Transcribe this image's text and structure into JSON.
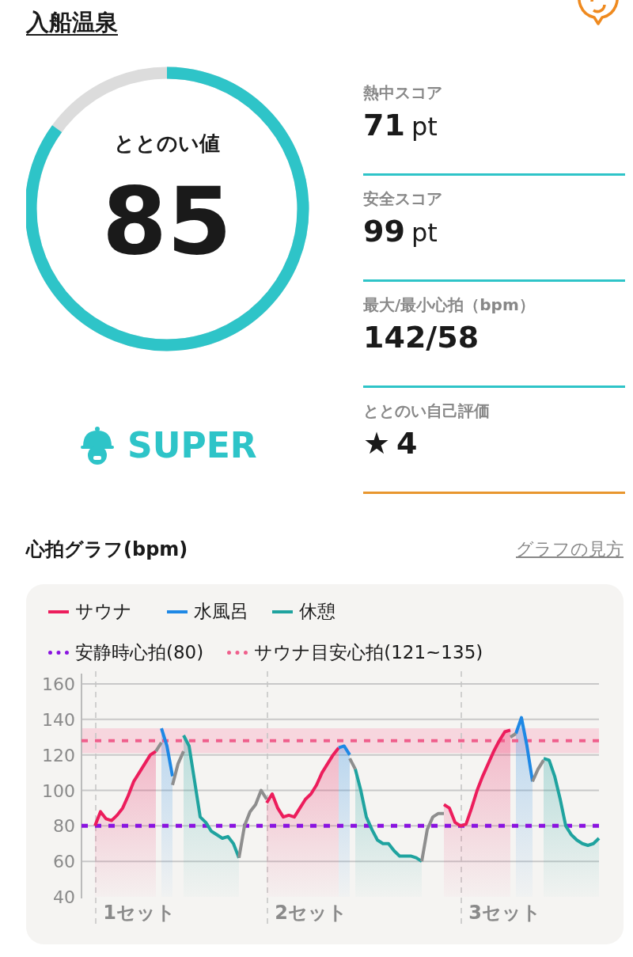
{
  "header": {
    "title": "入船温泉"
  },
  "gauge": {
    "label": "ととのい値",
    "value": "85",
    "rank": "SUPER"
  },
  "stats": [
    {
      "label": "熱中スコア",
      "value": "71",
      "unit": "pt",
      "color": "#2ec4c8"
    },
    {
      "label": "安全スコア",
      "value": "99",
      "unit": "pt",
      "color": "#2ec4c8"
    },
    {
      "label": "最大/最小心拍（bpm）",
      "value": "142/58",
      "color": "#2ec4c8"
    },
    {
      "label": "ととのい自己評価",
      "symbol": "★",
      "value": "4",
      "color": "#e8962e"
    }
  ],
  "graph": {
    "title": "心拍グラフ(bpm)",
    "help_link": "グラフの見方",
    "chart_data": {
      "type": "line",
      "ylim": [
        40,
        160
      ],
      "yticks": [
        40,
        60,
        80,
        100,
        120,
        140,
        160
      ],
      "grid": true,
      "categories": [
        null,
        null,
        null,
        null,
        null,
        null,
        null,
        null,
        "1セット",
        null,
        null,
        null,
        null,
        null,
        null,
        null,
        null,
        null,
        null,
        null,
        null,
        null,
        null,
        null,
        null,
        null,
        null,
        null,
        null,
        null,
        null,
        null,
        null,
        null,
        null,
        null,
        null,
        null,
        null,
        "2セット",
        null,
        null,
        null,
        null,
        null,
        null,
        null,
        null,
        null,
        null,
        null,
        null,
        null,
        null,
        null,
        null,
        null,
        null,
        null,
        null,
        null,
        null,
        null,
        null,
        null,
        null,
        null,
        null,
        null,
        null,
        null,
        null,
        null,
        null,
        "3セット",
        null,
        null,
        null,
        null,
        null,
        null,
        null,
        null,
        null,
        null,
        null,
        null,
        null,
        null,
        null,
        null,
        null
      ],
      "series": [
        {
          "name": "サウナ",
          "color": "#ec1d5c",
          "values": [
            80,
            88,
            84,
            83,
            86,
            90,
            97,
            105,
            110,
            115,
            120,
            122,
            null,
            null,
            null,
            null,
            null,
            null,
            null,
            null,
            null,
            null,
            null,
            null,
            null,
            null,
            null,
            null,
            null,
            null,
            null,
            93,
            98,
            90,
            85,
            86,
            85,
            90,
            95,
            98,
            103,
            110,
            115,
            120,
            124,
            null,
            null,
            null,
            null,
            null,
            null,
            null,
            null,
            null,
            null,
            null,
            null,
            null,
            null,
            null,
            null,
            null,
            null,
            92,
            90,
            82,
            80,
            81,
            90,
            100,
            108,
            115,
            122,
            128,
            133,
            134,
            null,
            null,
            null,
            null,
            null,
            null,
            null,
            null,
            null,
            null,
            null,
            null,
            null,
            null,
            null,
            null
          ]
        },
        {
          "name": "水風呂",
          "color": "#1e88e5",
          "values": [
            null,
            null,
            null,
            null,
            null,
            null,
            null,
            null,
            null,
            null,
            null,
            null,
            135,
            125,
            108,
            null,
            null,
            null,
            null,
            null,
            null,
            null,
            null,
            null,
            null,
            null,
            null,
            null,
            null,
            null,
            null,
            null,
            null,
            null,
            null,
            null,
            null,
            null,
            null,
            null,
            null,
            null,
            null,
            null,
            124,
            125,
            120,
            null,
            null,
            null,
            null,
            null,
            null,
            null,
            null,
            null,
            null,
            null,
            null,
            null,
            null,
            null,
            null,
            null,
            null,
            null,
            null,
            null,
            null,
            null,
            null,
            null,
            null,
            null,
            null,
            null,
            132,
            141,
            125,
            105,
            null,
            null,
            null,
            null,
            null,
            null,
            null,
            null,
            null,
            null,
            null,
            null
          ]
        },
        {
          "name": "休憩",
          "color": "#1fa39f",
          "values": [
            null,
            null,
            null,
            null,
            null,
            null,
            null,
            null,
            null,
            null,
            null,
            null,
            null,
            null,
            null,
            null,
            131,
            125,
            105,
            85,
            82,
            77,
            75,
            73,
            74,
            70,
            62,
            null,
            null,
            null,
            null,
            null,
            null,
            null,
            null,
            null,
            null,
            null,
            null,
            null,
            null,
            null,
            null,
            null,
            null,
            null,
            null,
            112,
            100,
            85,
            78,
            72,
            70,
            70,
            66,
            63,
            63,
            63,
            62,
            60,
            null,
            null,
            null,
            null,
            null,
            null,
            null,
            null,
            null,
            null,
            null,
            null,
            null,
            null,
            null,
            null,
            null,
            null,
            null,
            null,
            null,
            118,
            117,
            108,
            95,
            80,
            75,
            72,
            70,
            69,
            70,
            73
          ]
        },
        {
          "color": "#8e8e8e",
          "values": [
            null,
            null,
            null,
            null,
            null,
            null,
            null,
            null,
            null,
            null,
            null,
            122,
            127,
            null,
            103,
            115,
            122,
            null,
            null,
            null,
            null,
            null,
            null,
            null,
            null,
            null,
            62,
            80,
            88,
            92,
            100,
            95,
            null,
            null,
            null,
            null,
            null,
            null,
            null,
            null,
            null,
            null,
            null,
            null,
            null,
            null,
            118,
            112,
            null,
            null,
            null,
            null,
            null,
            null,
            null,
            null,
            null,
            null,
            null,
            60,
            78,
            85,
            87,
            87,
            null,
            null,
            null,
            null,
            null,
            null,
            null,
            null,
            null,
            null,
            null,
            130,
            132,
            null,
            null,
            105,
            112,
            117,
            null,
            null,
            null,
            null,
            null,
            null,
            null,
            null,
            null,
            null
          ]
        }
      ],
      "ref_lines": [
        {
          "axis": "y",
          "value": 80,
          "label": "安静時心拍(80)",
          "color": "#8a14e0"
        },
        {
          "axis": "y",
          "value": 128,
          "label": "サウナ目安心拍(121~135)",
          "color": "#ef5f8c"
        }
      ],
      "bands": [
        {
          "axis": "y",
          "from": 121,
          "to": 135,
          "color": "#f7d6de"
        }
      ]
    }
  }
}
